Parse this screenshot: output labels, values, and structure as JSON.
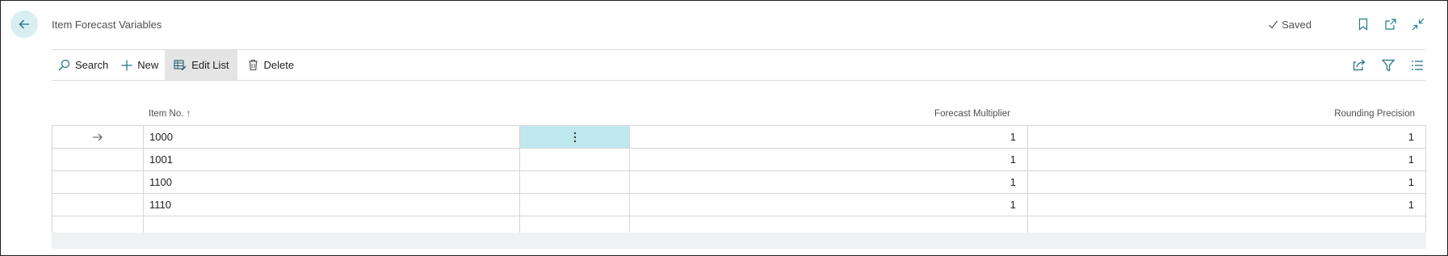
{
  "header": {
    "title": "Item Forecast Variables",
    "status": "Saved"
  },
  "toolbar": {
    "search_label": "Search",
    "new_label": "New",
    "edit_list_label": "Edit List",
    "delete_label": "Delete"
  },
  "table": {
    "columns": {
      "item_no": "Item No.",
      "sort_indicator": "↑",
      "forecast_multiplier": "Forecast Multiplier",
      "rounding_precision": "Rounding Precision"
    },
    "rows": [
      {
        "item_no": "1000",
        "forecast_multiplier": "1",
        "rounding_precision": "1",
        "selected": true
      },
      {
        "item_no": "1001",
        "forecast_multiplier": "1",
        "rounding_precision": "1",
        "selected": false
      },
      {
        "item_no": "1100",
        "forecast_multiplier": "1",
        "rounding_precision": "1",
        "selected": false
      },
      {
        "item_no": "1110",
        "forecast_multiplier": "1",
        "rounding_precision": "1",
        "selected": false
      },
      {
        "item_no": "",
        "forecast_multiplier": "",
        "rounding_precision": "",
        "selected": false
      }
    ]
  },
  "colors": {
    "accent": "#bfe8ee",
    "back_button_bg": "#d8eef2",
    "icon_teal": "#1f7f8f",
    "active_toolbar_bg": "#e4e4e4"
  },
  "icons": {
    "back": "arrow-left-icon",
    "saved": "checkmark-icon",
    "bookmark": "bookmark-icon",
    "open_new_window": "open-in-new-window-icon",
    "collapse": "collapse-icon",
    "search": "search-icon",
    "new": "plus-icon",
    "edit_list": "edit-list-icon",
    "delete": "trash-icon",
    "share": "share-icon",
    "filter": "filter-icon",
    "list_view": "list-view-icon",
    "row_selector": "arrow-right-icon",
    "row_menu": "more-vertical-icon"
  }
}
